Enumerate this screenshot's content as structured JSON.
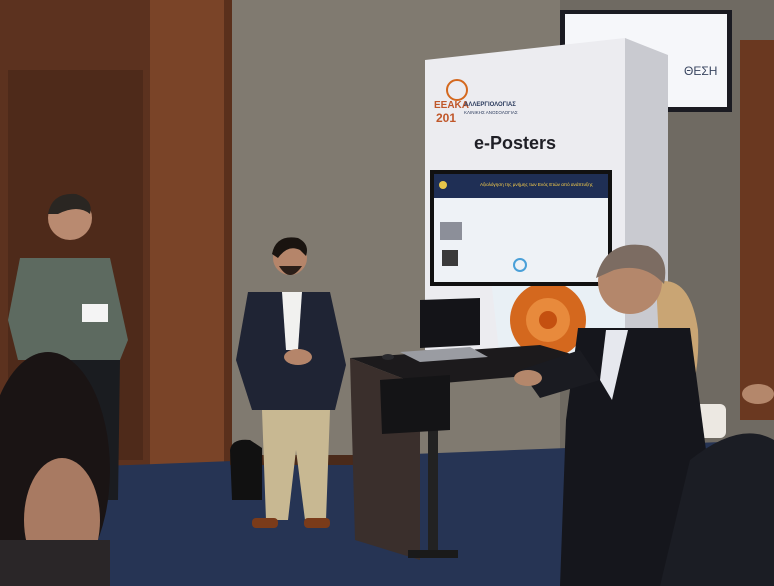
{
  "kiosk": {
    "logo_prefix": "ΕΕΑΚΑ",
    "logo_year": "201",
    "logo_org": "ΑΛΛΕΡΓΙΟΛΟΓΙΑΣ",
    "logo_sub": "ΚΛΙΝΙΚΗΣ ΑΝΟΣΟΛΟΓΙΑΣ",
    "title": "e-Posters"
  },
  "screen": {
    "heading": "Αξιολόγηση της μνήμης των Ενός Ετών από ανάπτυξης"
  },
  "wall_monitor": {
    "text": "ΘΕΣΗ"
  },
  "colors": {
    "wall": "#7a756c",
    "wood": "#6b3a22",
    "kiosk": "#e8e8ec",
    "floor": "#2a3a5c",
    "screen_bg": "#1a2a4a",
    "accent_orange": "#d4681e"
  }
}
